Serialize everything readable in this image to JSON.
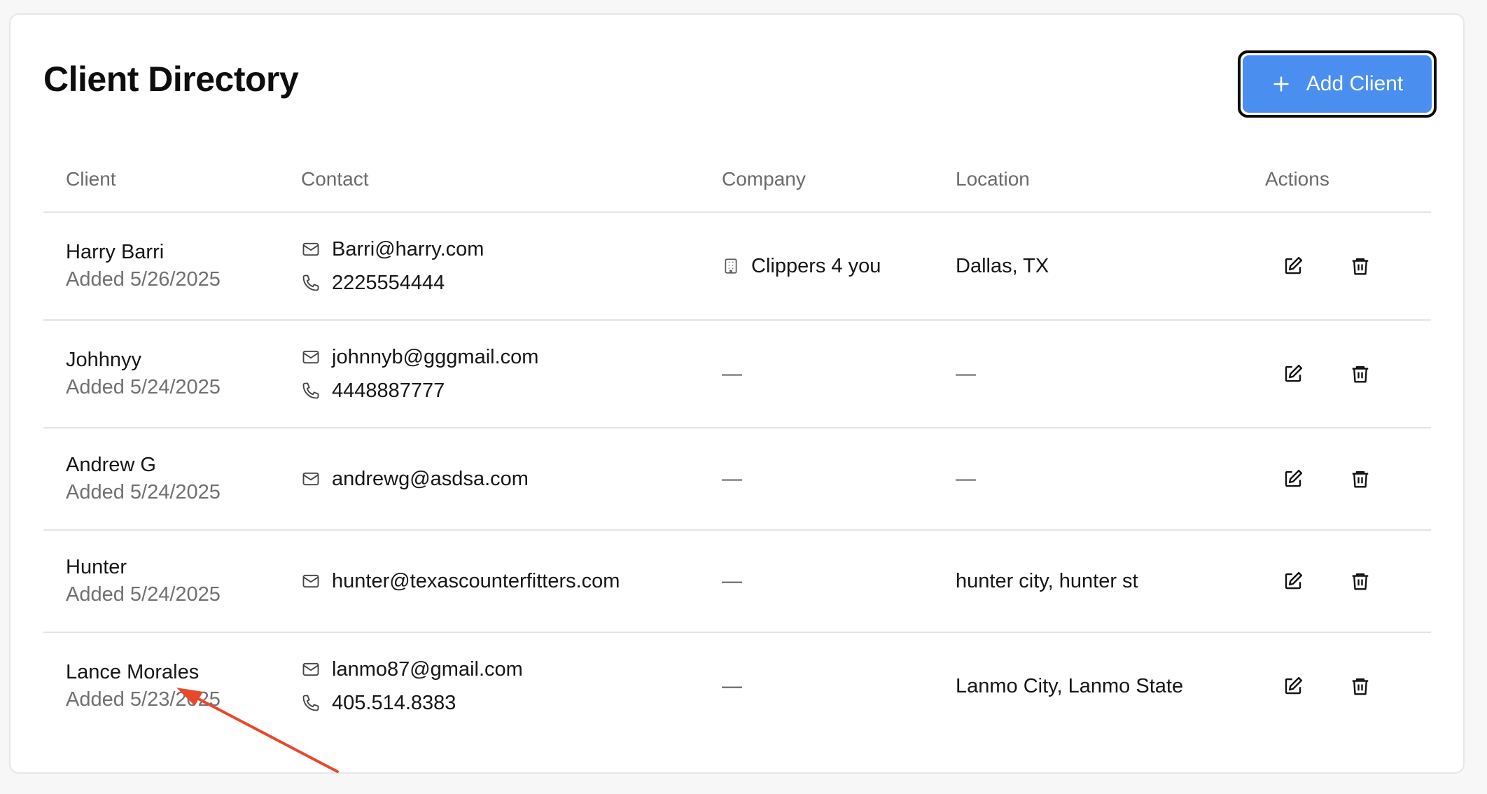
{
  "page": {
    "title": "Client Directory"
  },
  "toolbar": {
    "add_label": "Add Client"
  },
  "table": {
    "headers": {
      "client": "Client",
      "contact": "Contact",
      "company": "Company",
      "location": "Location",
      "actions": "Actions"
    },
    "rows": [
      {
        "name": "Harry Barri",
        "added": "Added 5/26/2025",
        "email": "Barri@harry.com",
        "phone": "2225554444",
        "company": "Clippers 4 you",
        "location": "Dallas, TX"
      },
      {
        "name": "Johhnyy",
        "added": "Added 5/24/2025",
        "email": "johnnyb@gggmail.com",
        "phone": "4448887777",
        "company": "—",
        "location": "—"
      },
      {
        "name": "Andrew G",
        "added": "Added 5/24/2025",
        "email": "andrewg@asdsa.com",
        "phone": "",
        "company": "—",
        "location": "—"
      },
      {
        "name": "Hunter",
        "added": "Added 5/24/2025",
        "email": "hunter@texascounterfitters.com",
        "phone": "",
        "company": "—",
        "location": "hunter city, hunter st"
      },
      {
        "name": "Lance Morales",
        "added": "Added 5/23/2025",
        "email": "lanmo87@gmail.com",
        "phone": "405.514.8383",
        "company": "—",
        "location": "Lanmo City, Lanmo State"
      }
    ]
  },
  "colors": {
    "accent": "#4a8ff0",
    "annotation_arrow": "#e8482c"
  },
  "icons": {
    "email": "mail-icon",
    "phone": "phone-icon",
    "company": "building-icon",
    "edit": "edit-icon",
    "delete": "trash-icon",
    "add": "plus-icon"
  }
}
